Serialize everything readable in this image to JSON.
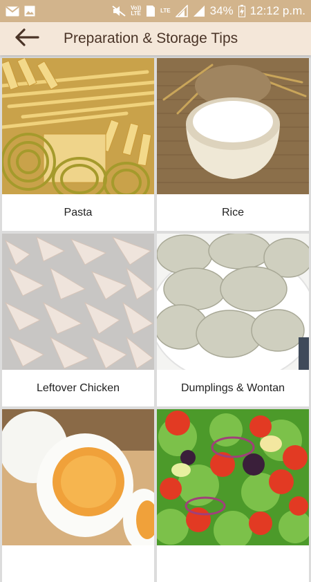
{
  "status_bar": {
    "network_label_top": "Vo))",
    "network_label_bottom": "LTE",
    "sim_slot": "1",
    "lte_label": "LTE",
    "battery": "34%",
    "time": "12:12 p.m."
  },
  "header": {
    "back_icon": "arrow-left-icon",
    "title": "Preparation & Storage Tips"
  },
  "cards": [
    {
      "label": "Pasta",
      "image": "pasta-photo"
    },
    {
      "label": "Rice",
      "image": "rice-bowl-photo"
    },
    {
      "label": "Leftover Chicken",
      "image": "shredded-chicken-photo"
    },
    {
      "label": "Dumplings & Wontan",
      "image": "dumplings-photo"
    },
    {
      "label": "",
      "image": "boiled-eggs-photo"
    },
    {
      "label": "",
      "image": "salad-photo"
    }
  ],
  "colors": {
    "status_bar": "#d2b48c",
    "app_bar": "#f4e7d9",
    "title_text": "#4a3427",
    "background": "#dcdcdc"
  }
}
